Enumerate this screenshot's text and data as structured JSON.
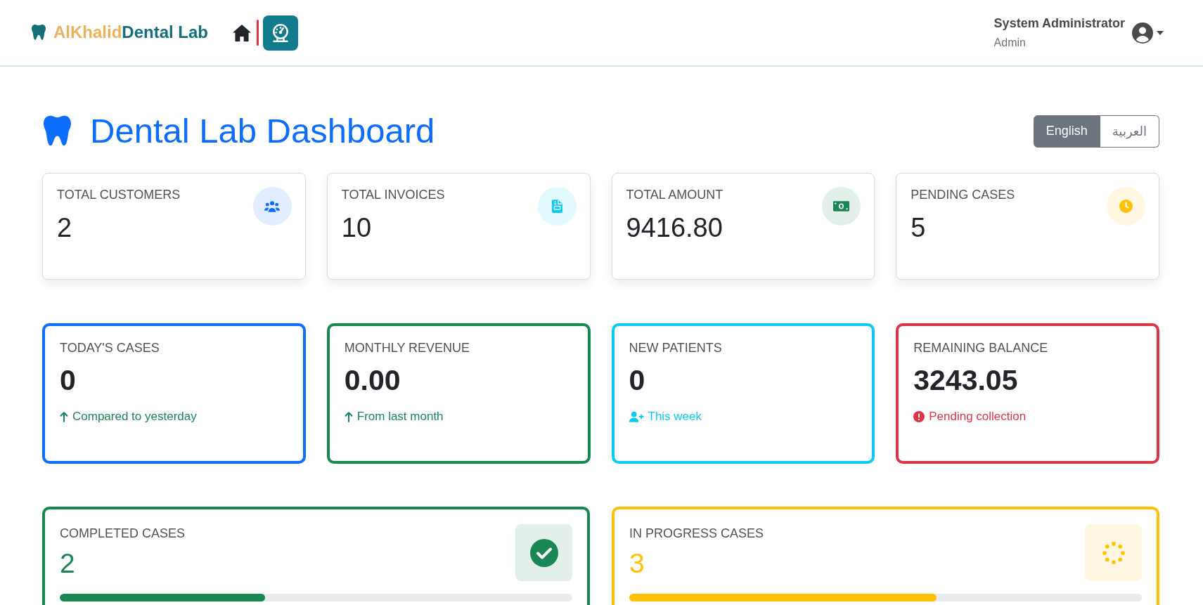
{
  "header": {
    "brand": {
      "first": "AlKhalid",
      "second": "Dental Lab"
    },
    "nav": [
      {
        "kind": "home",
        "selected": false
      },
      {
        "kind": "dashboard",
        "selected": true
      }
    ],
    "user": {
      "name": "System Administrator",
      "role": "Admin"
    }
  },
  "page": {
    "title": "Dental Lab Dashboard",
    "languages": [
      {
        "label": "English",
        "selected": true
      },
      {
        "label": "العربية",
        "selected": false
      }
    ]
  },
  "summary_cards": [
    {
      "label": "TOTAL CUSTOMERS",
      "value": "2",
      "kind": "users",
      "color": "#0d6efd"
    },
    {
      "label": "TOTAL INVOICES",
      "value": "10",
      "kind": "invoice",
      "color": "#0dcaf0"
    },
    {
      "label": "TOTAL AMOUNT",
      "value": "9416.80",
      "kind": "money",
      "color": "#198754"
    },
    {
      "label": "PENDING CASES",
      "value": "5",
      "kind": "clock",
      "color": "#ffc107"
    }
  ],
  "metric_cards": [
    {
      "label": "TODAY'S CASES",
      "value": "0",
      "color": "#0d6efd",
      "note": {
        "kind": "up",
        "text": "Compared to yesterday"
      }
    },
    {
      "label": "MONTHLY REVENUE",
      "value": "0.00",
      "color": "#198754",
      "note": {
        "kind": "up",
        "text": "From last month"
      }
    },
    {
      "label": "NEW PATIENTS",
      "value": "0",
      "color": "#0dcaf0",
      "note": {
        "kind": "new-user",
        "text": "This week"
      }
    },
    {
      "label": "REMAINING BALANCE",
      "value": "3243.05",
      "color": "#dc3545",
      "note": {
        "kind": "alert",
        "text": "Pending collection"
      }
    }
  ],
  "progress_cards": [
    {
      "label": "COMPLETED CASES",
      "value": "2",
      "level": 0.4,
      "kind": "completed",
      "color": "#198754"
    },
    {
      "label": "IN PROGRESS CASES",
      "value": "3",
      "level": 0.6,
      "kind": "in-progress",
      "color": "#ffc107"
    }
  ]
}
